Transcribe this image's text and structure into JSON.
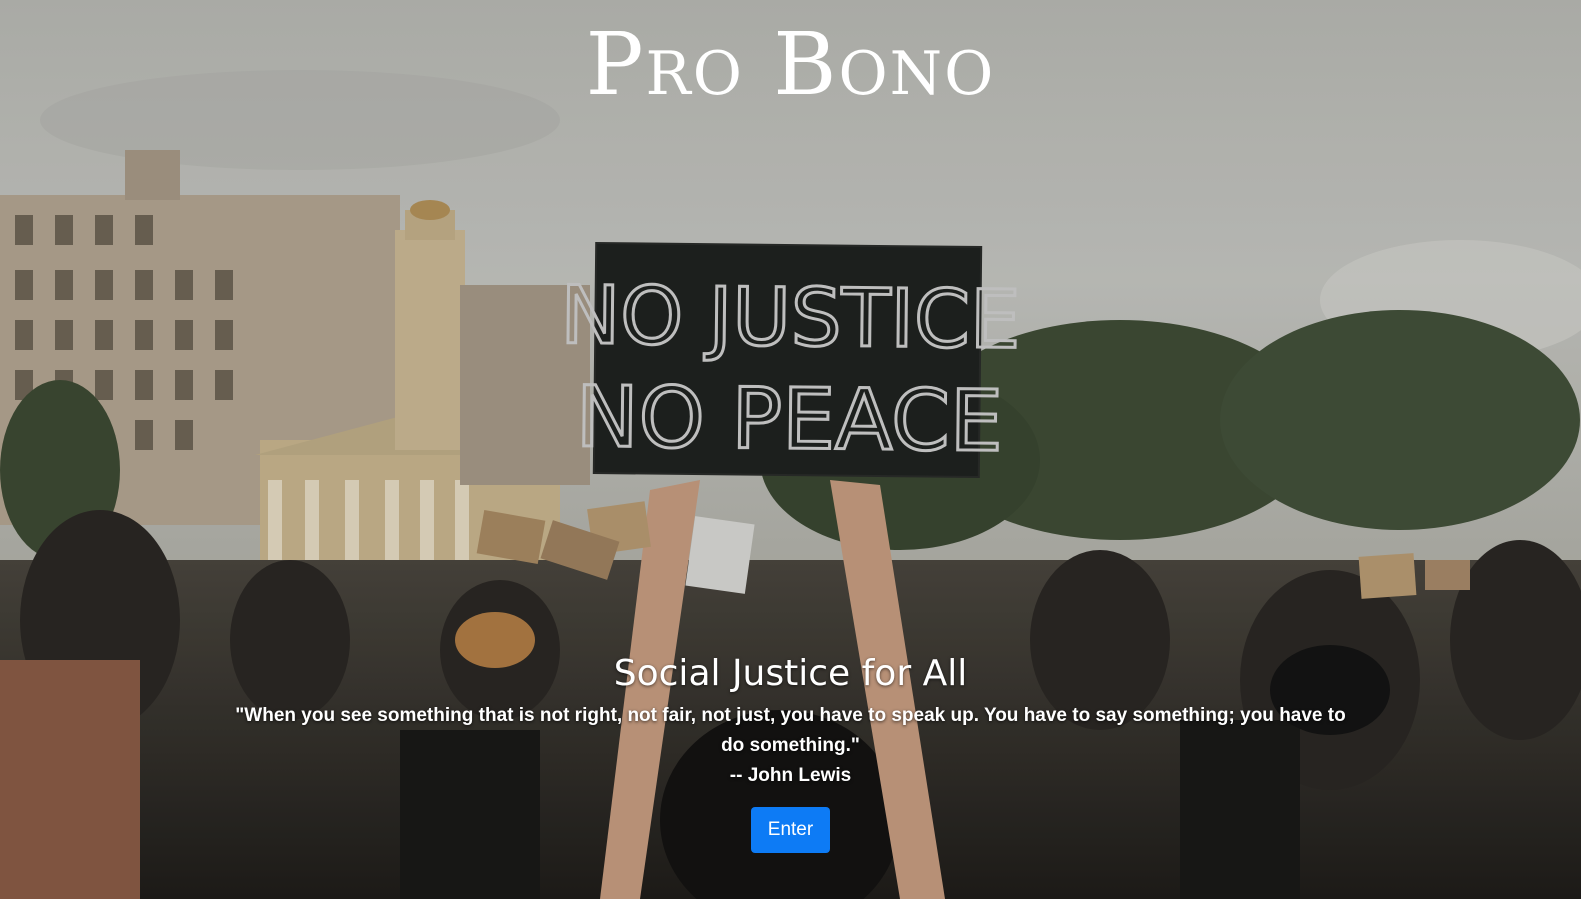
{
  "site": {
    "title": "Pro Bono"
  },
  "hero": {
    "sign_text_line1": "NO JUSTICE",
    "sign_text_line2": "NO PEACE",
    "tagline": "Social Justice for All",
    "quote": "\"When you see something that is not right, not fair, not just, you have to speak up. You have to say something; you have to do something.\"",
    "author": "-- John Lewis",
    "enter_label": "Enter"
  },
  "colors": {
    "button": "#0d7bf5",
    "text": "#ffffff"
  }
}
